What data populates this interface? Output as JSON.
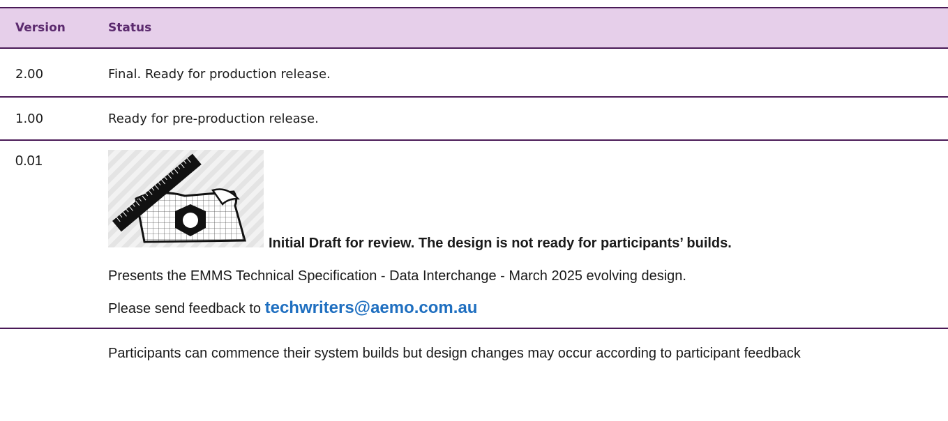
{
  "table": {
    "headers": {
      "version": "Version",
      "status": "Status"
    },
    "rows": [
      {
        "version": "2.00",
        "status": "Final. Ready for production release."
      },
      {
        "version": "1.00",
        "status": "Ready for pre-production release."
      },
      {
        "version": "0.01",
        "status_title": "Initial Draft for review. The design is not ready for participants’ builds.",
        "status_desc": "Presents the EMMS Technical Specification - Data Interchange - March 2025 evolving design.",
        "feedback_prefix": "Please send feedback to ",
        "feedback_email": "techwriters@aemo.com.au",
        "image_icon": "draft-design-icon"
      },
      {
        "version": "",
        "status": "Participants can commence their system builds but design changes may occur according to participant feedback"
      }
    ]
  },
  "colors": {
    "header_bg": "#e6cfea",
    "border": "#4a1a57",
    "header_text": "#5b2a6e",
    "link": "#1f6fc0"
  }
}
